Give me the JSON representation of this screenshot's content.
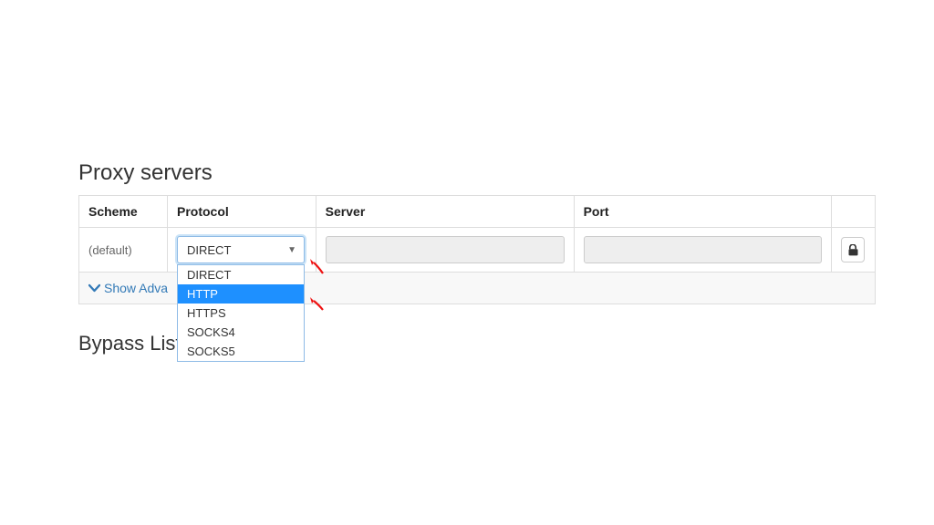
{
  "section": {
    "title": "Proxy servers"
  },
  "table": {
    "headers": {
      "scheme": "Scheme",
      "protocol": "Protocol",
      "server": "Server",
      "port": "Port"
    },
    "row": {
      "scheme": "(default)",
      "protocol_selected": "DIRECT",
      "server_value": "",
      "port_value": ""
    }
  },
  "protocol_options": [
    "DIRECT",
    "HTTP",
    "HTTPS",
    "SOCKS4",
    "SOCKS5"
  ],
  "protocol_highlighted": "HTTP",
  "advanced": {
    "label": "Show Adva"
  },
  "bypass": {
    "title": "Bypass List"
  },
  "icons": {
    "lock": "lock-icon",
    "chevron": "chevron-down-icon",
    "caret": "caret-down-icon"
  }
}
